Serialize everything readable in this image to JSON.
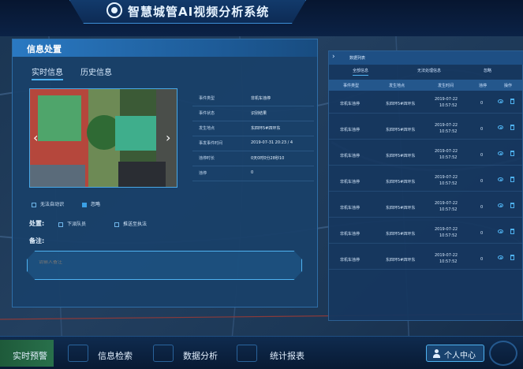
{
  "app": {
    "title": "智慧城管AI视频分析系统"
  },
  "info_panel": {
    "title": "信息处置",
    "tabs": [
      "实时信息",
      "历史信息"
    ],
    "details": [
      {
        "label": "事件类型",
        "value": "非机车违停"
      },
      {
        "label": "事件状态",
        "value": "识别结果"
      },
      {
        "label": "发生地点",
        "value": "东四环5#四环东"
      },
      {
        "label": "事发事件时间",
        "value": "2019-07-31 20:23 / 4"
      },
      {
        "label": "违停时长",
        "value": "0天0时0分28秒10"
      },
      {
        "label": "违停",
        "value": "0"
      }
    ],
    "checkbox_unable": "无法自动识",
    "checkbox_ignore": "忽略",
    "process_label": "处置:",
    "option_dispatch": "下派队员",
    "option_push": "推送至执法",
    "note_label": "备注:",
    "note_placeholder": "请输入备注"
  },
  "list_panel": {
    "title": "数据列表",
    "filter_tabs": [
      "全部信息",
      "无法处理信息",
      "忽略"
    ],
    "columns": [
      "事件类型",
      "发生地点",
      "发生时间",
      "违停",
      "操作"
    ],
    "rows": [
      {
        "type": "非机车违停",
        "place": "东四环5#四环东",
        "date": "2019-07-22",
        "time": "10:57:52",
        "count": "0"
      },
      {
        "type": "非机车违停",
        "place": "东四环5#四环东",
        "date": "2019-07-22",
        "time": "10:57:52",
        "count": "0"
      },
      {
        "type": "非机车违停",
        "place": "东四环5#四环东",
        "date": "2019-07-22",
        "time": "10:57:52",
        "count": "0"
      },
      {
        "type": "非机车违停",
        "place": "东四环5#四环东",
        "date": "2019-07-22",
        "time": "10:57:52",
        "count": "0"
      },
      {
        "type": "非机车违停",
        "place": "东四环5#四环东",
        "date": "2019-07-22",
        "time": "10:57:52",
        "count": "0"
      },
      {
        "type": "非机车违停",
        "place": "东四环5#四环东",
        "date": "2019-07-22",
        "time": "10:57:52",
        "count": "0"
      },
      {
        "type": "非机车违停",
        "place": "东四环5#四环东",
        "date": "2019-07-22",
        "time": "10:57:52",
        "count": "0"
      }
    ]
  },
  "bottom_nav": {
    "items": [
      "实时预警",
      "信息检索",
      "数据分析",
      "统计报表"
    ],
    "personal_center": "个人中心"
  },
  "colors": {
    "accent": "#4fb2f0",
    "panel": "#19416a",
    "active_nav": "#28704b"
  }
}
